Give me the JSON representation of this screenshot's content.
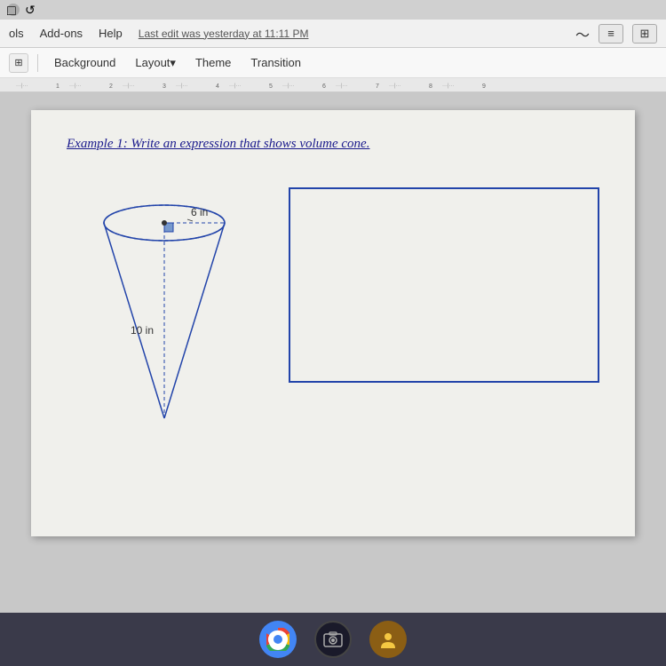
{
  "topbar": {
    "icon1": "●",
    "icon2": "↺"
  },
  "menubar": {
    "items": [
      "ols",
      "Add-ons",
      "Help"
    ],
    "last_edit": "Last edit was yesterday at 11:11 PM",
    "right_icons": [
      "~",
      "≡",
      "+"
    ]
  },
  "toolbar": {
    "icon": "⊞",
    "tabs": [
      "Background",
      "Layout▾",
      "Theme",
      "Transition"
    ]
  },
  "ruler": {
    "marks": "···1···|···2···|···3···|···4···5···|···6···|···7···|···8···|···9···"
  },
  "slide": {
    "title": "Example 1: Write an expression that shows volume cone.",
    "cone": {
      "radius_label": "6 in",
      "height_label": "10 in"
    }
  },
  "taskbar": {
    "icons": [
      "⊙",
      "⬤",
      "☻"
    ]
  }
}
